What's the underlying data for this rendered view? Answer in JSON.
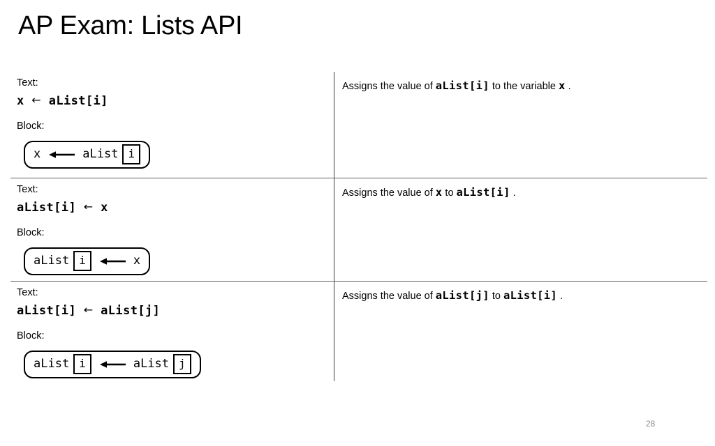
{
  "slide": {
    "title": "AP Exam: Lists API",
    "page_number": "28",
    "accent_color": "#000000",
    "divider_color": "#606060",
    "page_number_color": "#8d8d8d"
  },
  "table": {
    "labels": {
      "text_label": "Text:",
      "block_label": "Block:"
    },
    "rows": [
      {
        "text_code": {
          "before": "x ",
          "arrow": "←",
          "after": " aList[i]"
        },
        "block": {
          "tokens": [
            {
              "kind": "name",
              "value": "x"
            },
            {
              "kind": "arrow",
              "value": "←"
            },
            {
              "kind": "name",
              "value": "aList"
            },
            {
              "kind": "index",
              "value": "i"
            }
          ]
        },
        "description": {
          "lead": "Assigns the value of",
          "code1": "aList[i]",
          "middle": "to the variable",
          "code2": "x",
          "tail": "."
        }
      },
      {
        "text_code": {
          "before": "aList[i] ",
          "arrow": "←",
          "after": " x"
        },
        "block": {
          "tokens": [
            {
              "kind": "name",
              "value": "aList"
            },
            {
              "kind": "index",
              "value": "i"
            },
            {
              "kind": "arrow",
              "value": "←"
            },
            {
              "kind": "name",
              "value": "x"
            }
          ]
        },
        "description": {
          "lead": "Assigns the value of",
          "code1": "x",
          "middle": "to",
          "code2": "aList[i]",
          "tail": "."
        }
      },
      {
        "text_code": {
          "before": "aList[i] ",
          "arrow": "←",
          "after": " aList[j]"
        },
        "block": {
          "tokens": [
            {
              "kind": "name",
              "value": "aList"
            },
            {
              "kind": "index",
              "value": "i"
            },
            {
              "kind": "arrow",
              "value": "←"
            },
            {
              "kind": "name",
              "value": "aList"
            },
            {
              "kind": "index",
              "value": "j"
            }
          ]
        },
        "description": {
          "lead": "Assigns the value of",
          "code1": "aList[j]",
          "middle": "to",
          "code2": "aList[i]",
          "tail": "."
        }
      }
    ]
  }
}
